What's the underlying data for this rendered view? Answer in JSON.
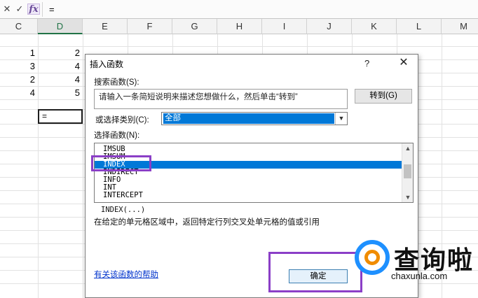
{
  "formula_bar": {
    "cancel_icon": "✕",
    "enter_icon": "✓",
    "fx_label": "fx",
    "content": "="
  },
  "columns": [
    "C",
    "D",
    "E",
    "F",
    "G",
    "H",
    "I",
    "J",
    "K",
    "L",
    "M"
  ],
  "cells": {
    "C": [
      "1",
      "3",
      "2",
      "4"
    ],
    "D": [
      "2",
      "4",
      "4",
      "5"
    ]
  },
  "active_cell": {
    "value": "="
  },
  "dialog": {
    "title": "插入函数",
    "help": "?",
    "close": "✕",
    "search_label": "搜索函数(S):",
    "search_text": "请输入一条简短说明来描述您想做什么，然后单击“转到”",
    "go_button": "转到(G)",
    "category_label": "或选择类别(C):",
    "category_value": "全部",
    "function_label": "选择函数(N):",
    "functions": [
      "IMSUB",
      "IMSUM",
      "INDEX",
      "INDIRECT",
      "INFO",
      "INT",
      "INTERCEPT"
    ],
    "selected_function": "INDEX",
    "syntax": "INDEX(...)",
    "description": "在给定的单元格区域中，返回特定行列交叉处单元格的值或引用",
    "help_link": "有关该函数的帮助",
    "ok_button": "确定"
  },
  "watermark": {
    "brand": "查询啦",
    "domain": "chaxunla.com"
  },
  "colors": {
    "selection": "#0078d7",
    "highlight_box": "#8b3fc7",
    "link": "#0033cc"
  }
}
